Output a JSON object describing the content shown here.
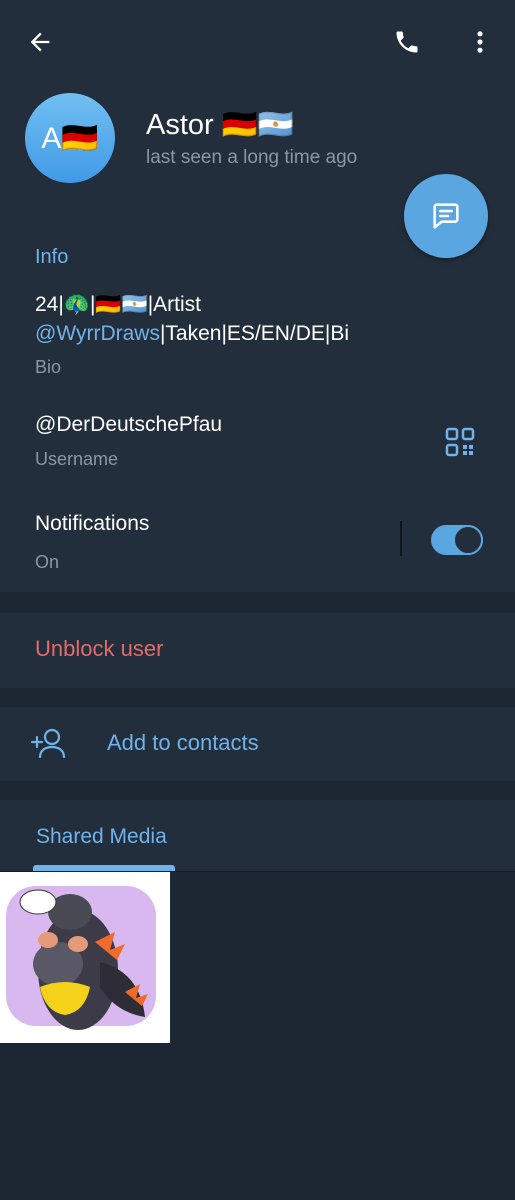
{
  "header": {
    "name": "Astor 🇩🇪🇦🇷",
    "status": "last seen a long time ago",
    "avatar_text": "A🇩🇪"
  },
  "info": {
    "section_title": "Info",
    "bio_line1": "24|🦚|🇩🇪🇦🇷|Artist",
    "bio_link": "@WyrrDraws",
    "bio_line2_rest": "|Taken|ES/EN/DE|Bi",
    "bio_label": "Bio",
    "username_value": "@DerDeutschePfau",
    "username_label": "Username",
    "notifications_label": "Notifications",
    "notifications_state": "On"
  },
  "actions": {
    "unblock": "Unblock user",
    "add_contacts": "Add to contacts"
  },
  "media": {
    "tab_label": "Shared Media"
  },
  "colors": {
    "accent": "#6fb3ea",
    "danger": "#e26a6a",
    "background": "#1d2733",
    "surface": "#232e3c"
  },
  "icons": [
    "back-arrow-icon",
    "phone-icon",
    "more-vertical-icon",
    "message-icon",
    "qr-code-icon",
    "add-user-icon"
  ]
}
